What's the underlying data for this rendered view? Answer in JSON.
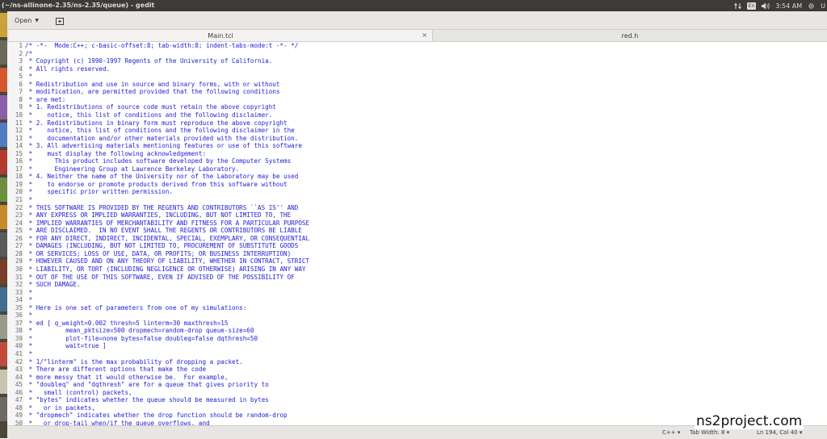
{
  "topbar": {
    "title": "(~/ns-allinone-2.35/ns-2.35/queue) - gedit",
    "keyboard_label": "En",
    "clock": "3:54 AM",
    "user_initial": "U"
  },
  "toolbar": {
    "open_label": "Open"
  },
  "tabs": [
    {
      "label": "Main.tcl",
      "close": "×"
    },
    {
      "label": "red.h"
    }
  ],
  "editor": {
    "lines": [
      {
        "n": "1",
        "text": "/* -*-  Mode:C++; c-basic-offset:8; tab-width:8; indent-tabs-mode:t -*- */"
      },
      {
        "n": "2",
        "text": "/*"
      },
      {
        "n": "3",
        "text": " * Copyright (c) 1990-1997 Regents of the University of California."
      },
      {
        "n": "4",
        "text": " * All rights reserved."
      },
      {
        "n": "5",
        "text": " *"
      },
      {
        "n": "6",
        "text": " * Redistribution and use in source and binary forms, with or without"
      },
      {
        "n": "7",
        "text": " * modification, are permitted provided that the following conditions"
      },
      {
        "n": "8",
        "text": " * are met:"
      },
      {
        "n": "9",
        "text": " * 1. Redistributions of source code must retain the above copyright"
      },
      {
        "n": "10",
        "text": " *    notice, this list of conditions and the following disclaimer."
      },
      {
        "n": "11",
        "text": " * 2. Redistributions in binary form must reproduce the above copyright"
      },
      {
        "n": "12",
        "text": " *    notice, this list of conditions and the following disclaimer in the"
      },
      {
        "n": "13",
        "text": " *    documentation and/or other materials provided with the distribution."
      },
      {
        "n": "14",
        "text": " * 3. All advertising materials mentioning features or use of this software"
      },
      {
        "n": "15",
        "text": " *    must display the following acknowledgement:"
      },
      {
        "n": "16",
        "text": " *      This product includes software developed by the Computer Systems"
      },
      {
        "n": "17",
        "text": " *      Engineering Group at Lawrence Berkeley Laboratory."
      },
      {
        "n": "18",
        "text": " * 4. Neither the name of the University nor of the Laboratory may be used"
      },
      {
        "n": "19",
        "text": " *    to endorse or promote products derived from this software without"
      },
      {
        "n": "20",
        "text": " *    specific prior written permission."
      },
      {
        "n": "21",
        "text": " *"
      },
      {
        "n": "22",
        "text": " * THIS SOFTWARE IS PROVIDED BY THE REGENTS AND CONTRIBUTORS ``AS IS'' AND"
      },
      {
        "n": "23",
        "text": " * ANY EXPRESS OR IMPLIED WARRANTIES, INCLUDING, BUT NOT LIMITED TO, THE"
      },
      {
        "n": "24",
        "text": " * IMPLIED WARRANTIES OF MERCHANTABILITY AND FITNESS FOR A PARTICULAR PURPOSE"
      },
      {
        "n": "25",
        "text": " * ARE DISCLAIMED.  IN NO EVENT SHALL THE REGENTS OR CONTRIBUTORS BE LIABLE"
      },
      {
        "n": "26",
        "text": " * FOR ANY DIRECT, INDIRECT, INCIDENTAL, SPECIAL, EXEMPLARY, OR CONSEQUENTIAL"
      },
      {
        "n": "27",
        "text": " * DAMAGES (INCLUDING, BUT NOT LIMITED TO, PROCUREMENT OF SUBSTITUTE GOODS"
      },
      {
        "n": "28",
        "text": " * OR SERVICES; LOSS OF USE, DATA, OR PROFITS; OR BUSINESS INTERRUPTION)"
      },
      {
        "n": "29",
        "text": " * HOWEVER CAUSED AND ON ANY THEORY OF LIABILITY, WHETHER IN CONTRACT, STRICT"
      },
      {
        "n": "30",
        "text": " * LIABILITY, OR TORT (INCLUDING NEGLIGENCE OR OTHERWISE) ARISING IN ANY WAY"
      },
      {
        "n": "31",
        "text": " * OUT OF THE USE OF THIS SOFTWARE, EVEN IF ADVISED OF THE POSSIBILITY OF"
      },
      {
        "n": "32",
        "text": " * SUCH DAMAGE."
      },
      {
        "n": "33",
        "text": " *"
      },
      {
        "n": "34",
        "text": " *"
      },
      {
        "n": "35",
        "text": " * Here is one set of parameters from one of my simulations:"
      },
      {
        "n": "36",
        "text": " *"
      },
      {
        "n": "37",
        "text": " * ed [ q_weight=0.002 thresh=5 linterm=30 maxthresh=15"
      },
      {
        "n": "38",
        "text": " *         mean_pktsize=500 dropmech=random-drop queue-size=60"
      },
      {
        "n": "39",
        "text": " *         plot-file=none bytes=false doubleq=false dqthresh=50"
      },
      {
        "n": "40",
        "text": " *         wait=true ]"
      },
      {
        "n": "41",
        "text": " *"
      },
      {
        "n": "42",
        "text": " * 1/\"linterm\" is the max probability of dropping a packet."
      },
      {
        "n": "43",
        "text": " * There are different options that make the code"
      },
      {
        "n": "44",
        "text": " * more messy that it would otherwise be.  For example,"
      },
      {
        "n": "45",
        "text": " * \"doubleq\" and \"dqthresh\" are for a queue that gives priority to"
      },
      {
        "n": "46",
        "text": " *   small (control) packets,"
      },
      {
        "n": "47",
        "text": " * \"bytes\" indicates whether the queue should be measured in bytes"
      },
      {
        "n": "48",
        "text": " *   or in packets,"
      },
      {
        "n": "49",
        "text": " * \"dropmech\" indicates whether the drop function should be random-drop"
      },
      {
        "n": "50",
        "text": " *   or drop-tail when/if the queue overflows, and"
      }
    ]
  },
  "statusbar": {
    "language": "C++ ▾",
    "tab_width": "Tab Width: 8 ▾",
    "cursor": "Ln 194, Col 40 ▾"
  },
  "watermark": "ns2project.com"
}
